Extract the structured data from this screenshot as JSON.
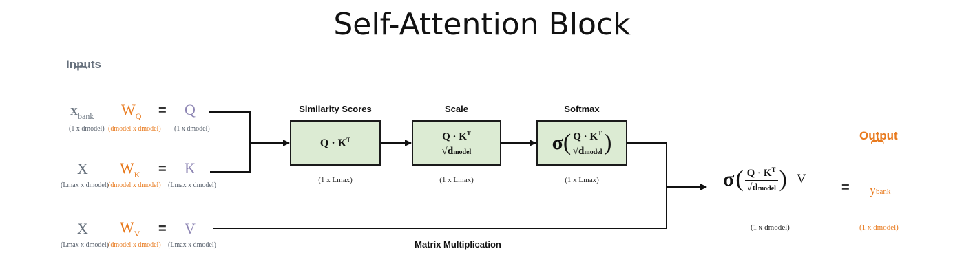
{
  "title": "Self-Attention Block",
  "inputs": {
    "label": "Inputs",
    "brace": "{",
    "rows": [
      {
        "x": "x",
        "x_sub": "bank",
        "x_dim": "(1 x dmodel)",
        "w": "W",
        "w_sub": "Q",
        "w_dim": "(dmodel x dmodel)",
        "eq": "=",
        "out": "Q",
        "out_dim": "(1 x dmodel)"
      },
      {
        "x": "X",
        "x_sub": "",
        "x_dim": "(Lmax x dmodel)",
        "w": "W",
        "w_sub": "K",
        "w_dim": "(dmodel x dmodel)",
        "eq": "=",
        "out": "K",
        "out_dim": "(Lmax x dmodel)"
      },
      {
        "x": "X",
        "x_sub": "",
        "x_dim": "(Lmax x dmodel)",
        "w": "W",
        "w_sub": "V",
        "w_dim": "(dmodel x dmodel)",
        "eq": "=",
        "out": "V",
        "out_dim": "(Lmax x dmodel)"
      }
    ]
  },
  "stages": [
    {
      "title": "Similarity Scores",
      "shape": "(1 x Lmax)"
    },
    {
      "title": "Scale",
      "shape": "(1 x Lmax)"
    },
    {
      "title": "Softmax",
      "shape": "(1 x Lmax)"
    }
  ],
  "formula": {
    "qk": "Q · K",
    "T": "T",
    "sqrt": "√",
    "d": "d",
    "model": "model",
    "sigma": "σ",
    "lparen": "(",
    "rparen": ")",
    "v": "V"
  },
  "matmul_label": "Matrix Multiplication",
  "result": {
    "shape": "(1 x dmodel)",
    "eq": "="
  },
  "output": {
    "label": "Output",
    "brace": "{",
    "y": "y",
    "y_sub": "bank",
    "dim": "(1 x dmodel)"
  },
  "colors": {
    "gray": "#66707c",
    "orange": "#e87a1e",
    "purple": "#8e86b4",
    "box_fill": "#dcebd3"
  }
}
